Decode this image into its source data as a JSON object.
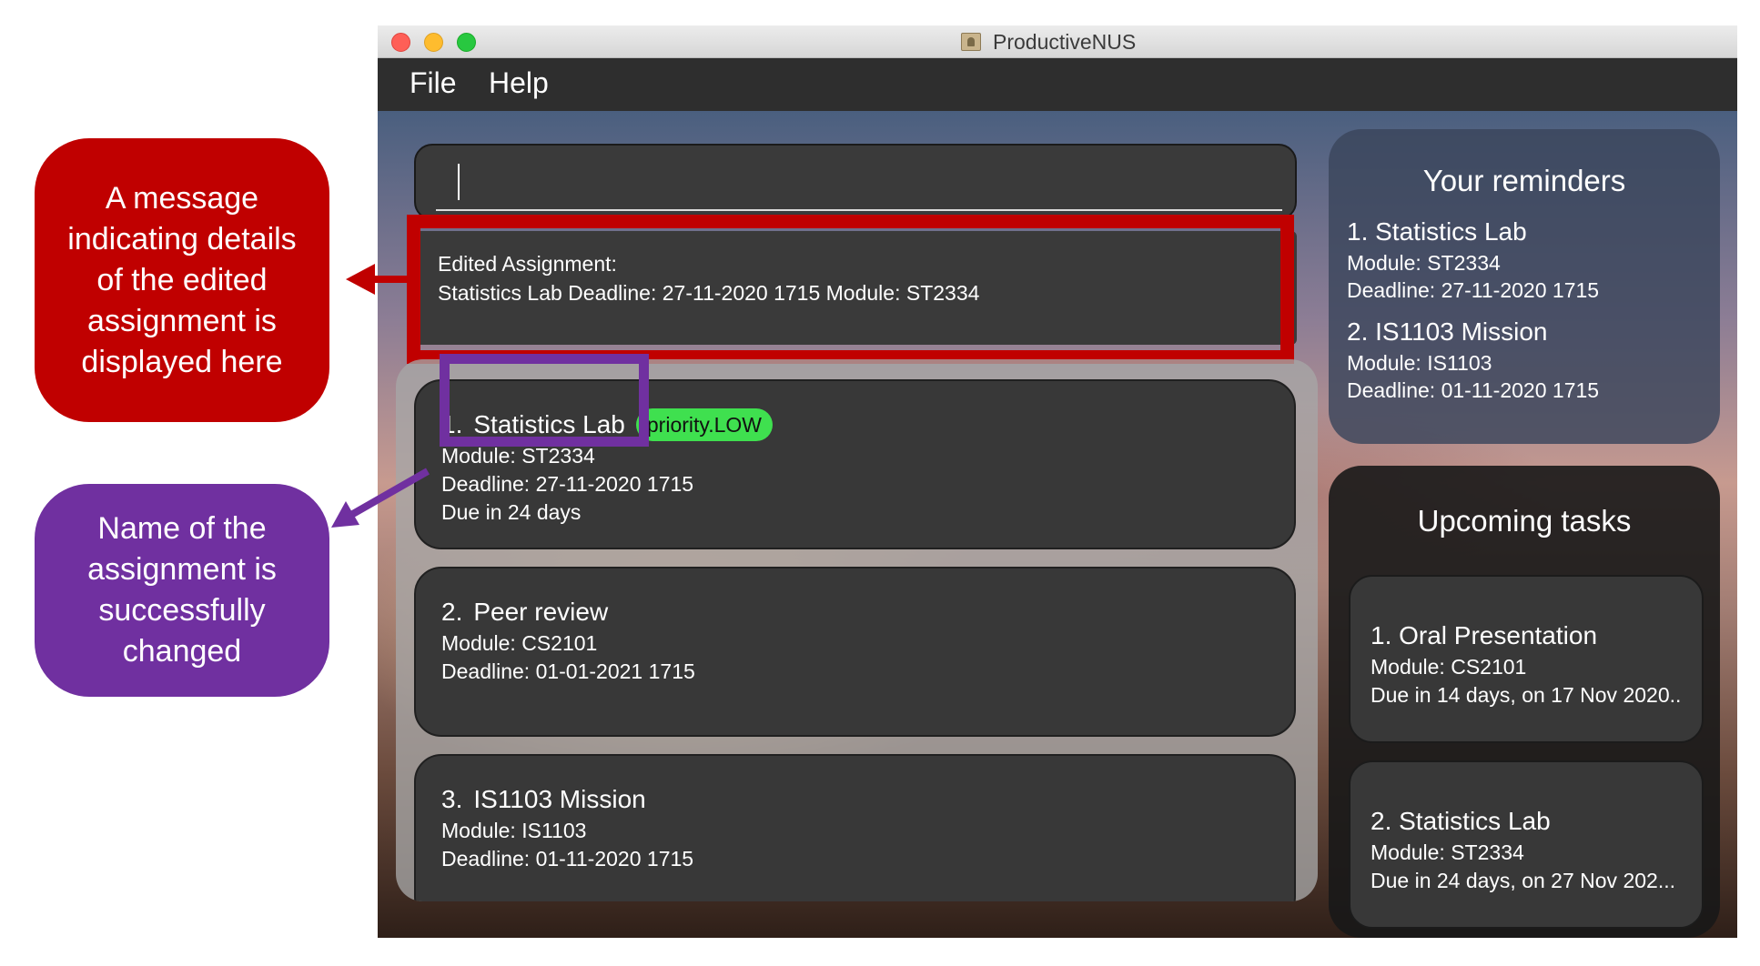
{
  "window": {
    "title": "ProductiveNUS"
  },
  "menu": {
    "file": "File",
    "help": "Help"
  },
  "command_box": {
    "value": ""
  },
  "result": {
    "line1": "Edited Assignment:",
    "line2": "Statistics Lab Deadline: 27-11-2020 1715 Module: ST2334"
  },
  "assignments": [
    {
      "index": "1.",
      "name": "Statistics Lab",
      "tag": "priority.LOW",
      "module": "Module: ST2334",
      "deadline": "Deadline: 27-11-2020 1715",
      "due": "Due in 24 days"
    },
    {
      "index": "2.",
      "name": "Peer review",
      "module": "Module: CS2101",
      "deadline": "Deadline: 01-01-2021 1715"
    },
    {
      "index": "3.",
      "name": "IS1103 Mission",
      "module": "Module: IS1103",
      "deadline": "Deadline: 01-11-2020 1715"
    }
  ],
  "reminders": {
    "title": "Your reminders",
    "items": [
      {
        "name": "1.  Statistics Lab",
        "module": "Module: ST2334",
        "deadline": "Deadline: 27-11-2020 1715"
      },
      {
        "name": "2.  IS1103 Mission",
        "module": "Module: IS1103",
        "deadline": "Deadline: 01-11-2020 1715"
      }
    ]
  },
  "upcoming": {
    "title": "Upcoming tasks",
    "items": [
      {
        "name": "1.  Oral Presentation",
        "module": "Module: CS2101",
        "due": "Due in 14 days, on 17 Nov 2020..."
      },
      {
        "name": "2.  Statistics Lab",
        "module": "Module: ST2334",
        "due": "Due in 24 days, on 27 Nov 202..."
      }
    ]
  },
  "annotations": {
    "red": {
      "lines": [
        "A message",
        "indicating details",
        "of the edited",
        "assignment is",
        "displayed here"
      ],
      "color": "#c00000"
    },
    "purple": {
      "lines": [
        "Name of the",
        "assignment is",
        "successfully",
        "changed"
      ],
      "color": "#7030a0"
    }
  },
  "colors": {
    "tag_green": "#3fe04f",
    "card_bg": "#383838",
    "highlight_red": "#c00000",
    "highlight_purple": "#7030a0"
  }
}
